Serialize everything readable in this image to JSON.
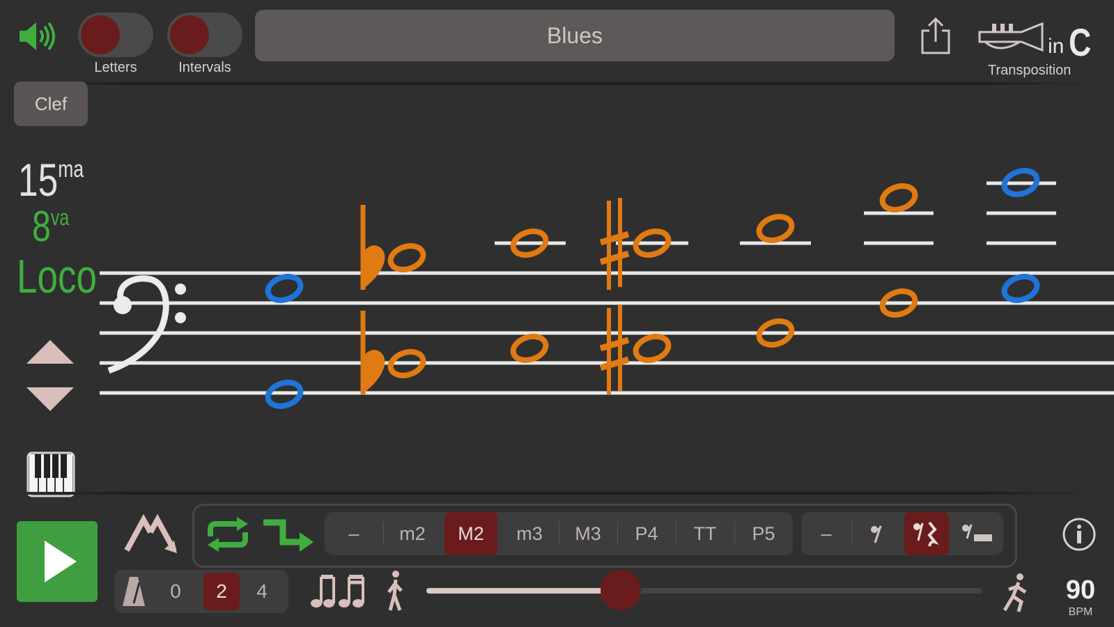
{
  "header": {
    "title": "Blues",
    "toggles": [
      {
        "label": "Letters",
        "on": false
      },
      {
        "label": "Intervals",
        "on": false
      }
    ],
    "transposition": {
      "label": "Transposition",
      "instrument_icon": "trumpet-icon",
      "key_prefix": "in",
      "key": "C"
    }
  },
  "left_panel": {
    "clef_button": "Clef",
    "octave_options": [
      {
        "main": "15",
        "sup": "ma",
        "active": false
      },
      {
        "main": "8",
        "sup": "va",
        "active": true
      },
      {
        "main": "Loco",
        "sup": "",
        "active": true
      }
    ]
  },
  "staff": {
    "clef": "bass",
    "notes_orange": "note-orange",
    "notes_blue": "note-blue"
  },
  "bottom": {
    "interval_options": [
      "–",
      "m2",
      "M2",
      "m3",
      "M3",
      "P4",
      "TT",
      "P5"
    ],
    "interval_selected": "M2",
    "rest_options_selected_index": 2,
    "rest_first": "–",
    "count_in_options": [
      "0",
      "2",
      "4"
    ],
    "count_in_selected": "2",
    "tempo": {
      "value": "90",
      "unit": "BPM",
      "slider_fraction": 0.35
    }
  },
  "colors": {
    "accent_green": "#3f9e3f",
    "selected_red": "#6a1c1c",
    "note_orange": "#e07a12",
    "note_blue": "#1f74d8"
  }
}
